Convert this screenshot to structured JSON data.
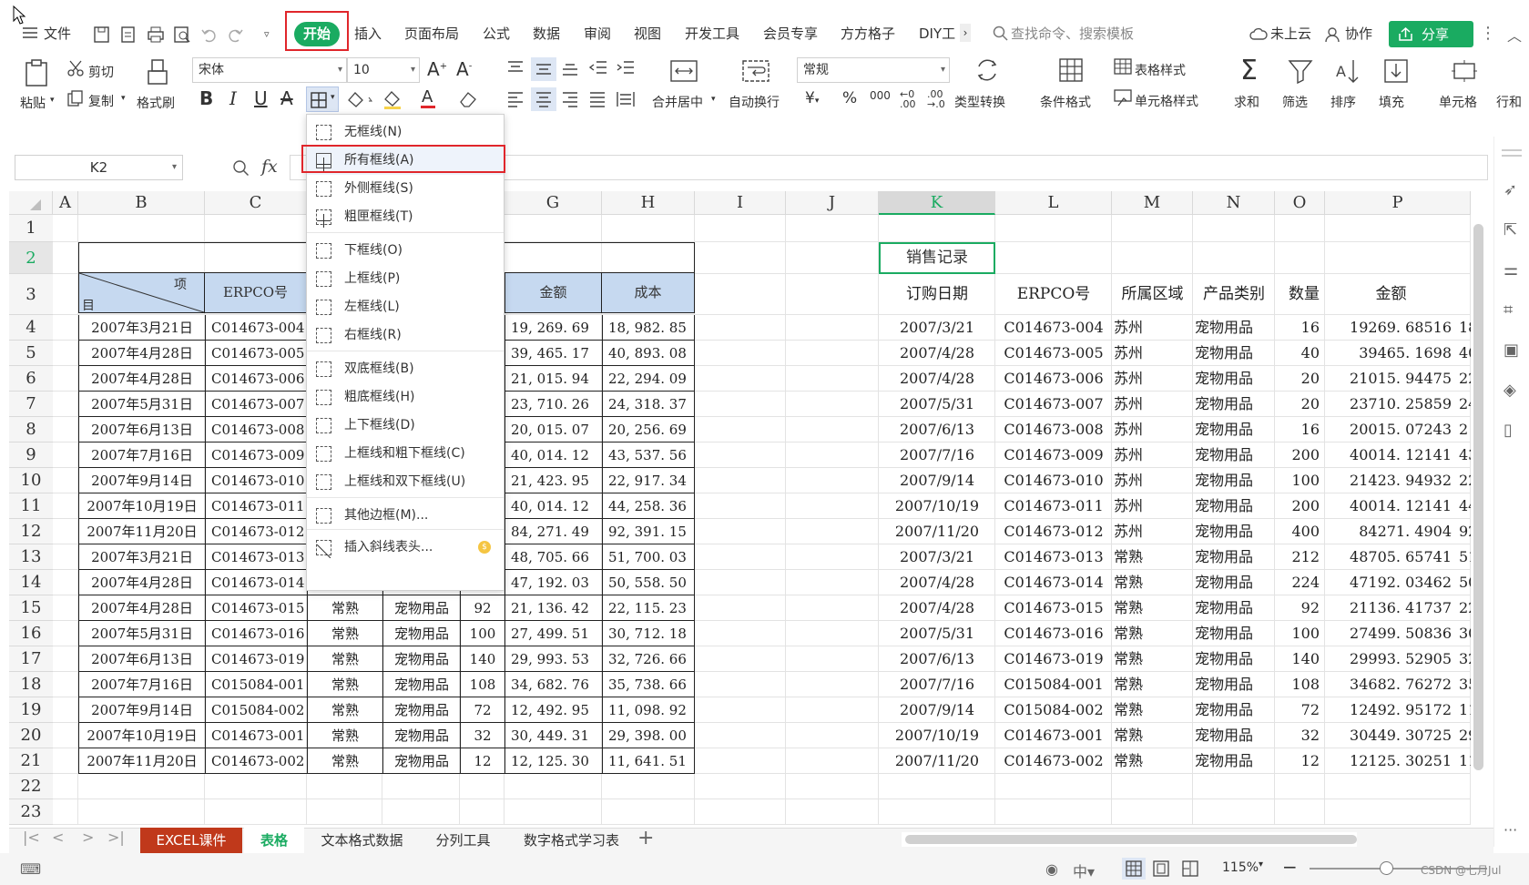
{
  "menu": {
    "file": "文件",
    "start": "开始",
    "tabs": [
      "插入",
      "页面布局",
      "公式",
      "数据",
      "审阅",
      "视图",
      "开发工具",
      "会员专享",
      "方方格子",
      "DIY工"
    ],
    "search": "查找命令、搜索模板",
    "cloud": "未上云",
    "collab": "协作",
    "share": "分享"
  },
  "ribbon": {
    "paste": "粘贴",
    "cut": "剪切",
    "copy": "复制",
    "format_painter": "格式刷",
    "font_name": "宋体",
    "font_size": "10",
    "bold": "B",
    "italic": "I",
    "underline": "U",
    "merge_center": "合并居中",
    "wrap_text": "自动换行",
    "number_format": "常规",
    "type_convert": "类型转换",
    "cond_format": "条件格式",
    "table_style": "表格样式",
    "cell_style": "单元格样式",
    "sum": "求和",
    "filter": "筛选",
    "sort": "排序",
    "fill": "填充",
    "cell": "单元格",
    "row_col": "行和"
  },
  "formula_bar": {
    "name_box": "K2",
    "fx": "fx"
  },
  "columns": [
    "A",
    "B",
    "C",
    "D",
    "E",
    "F",
    "G",
    "H",
    "I",
    "J",
    "K",
    "L",
    "M",
    "N",
    "O",
    "P"
  ],
  "rows": [
    "1",
    "2",
    "3",
    "4",
    "5",
    "6",
    "7",
    "8",
    "9",
    "10",
    "11",
    "12",
    "13",
    "14",
    "15",
    "16",
    "17",
    "18",
    "19",
    "20",
    "21",
    "22",
    "23"
  ],
  "left_table": {
    "header_diag_top": "项",
    "header_diag_bottom": "目",
    "headers": [
      "ERPCO号",
      "金额",
      "成本"
    ],
    "rows": [
      [
        "2007年3月21日",
        "C014673-004",
        "",
        "",
        "",
        "19, 269. 69",
        "18, 982. 85"
      ],
      [
        "2007年4月28日",
        "C014673-005",
        "",
        "",
        "",
        "39, 465. 17",
        "40, 893. 08"
      ],
      [
        "2007年4月28日",
        "C014673-006",
        "",
        "",
        "",
        "21, 015. 94",
        "22, 294. 09"
      ],
      [
        "2007年5月31日",
        "C014673-007",
        "",
        "",
        "",
        "23, 710. 26",
        "24, 318. 37"
      ],
      [
        "2007年6月13日",
        "C014673-008",
        "",
        "",
        "",
        "20, 015. 07",
        "20, 256. 69"
      ],
      [
        "2007年7月16日",
        "C014673-009",
        "",
        "",
        "",
        "40, 014. 12",
        "43, 537. 56"
      ],
      [
        "2007年9月14日",
        "C014673-010",
        "",
        "",
        "",
        "21, 423. 95",
        "22, 917. 34"
      ],
      [
        "2007年10月19日",
        "C014673-011",
        "",
        "",
        "",
        "40, 014. 12",
        "44, 258. 36"
      ],
      [
        "2007年11月20日",
        "C014673-012",
        "",
        "",
        "",
        "84, 271. 49",
        "92, 391. 15"
      ],
      [
        "2007年3月21日",
        "C014673-013",
        "",
        "",
        "",
        "48, 705. 66",
        "51, 700. 03"
      ],
      [
        "2007年4月28日",
        "C014673-014",
        "",
        "",
        "",
        "47, 192. 03",
        "50, 558. 50"
      ],
      [
        "2007年4月28日",
        "C014673-015",
        "常熟",
        "宠物用品",
        "92",
        "21, 136. 42",
        "22, 115. 23"
      ],
      [
        "2007年5月31日",
        "C014673-016",
        "常熟",
        "宠物用品",
        "100",
        "27, 499. 51",
        "30, 712. 18"
      ],
      [
        "2007年6月13日",
        "C014673-019",
        "常熟",
        "宠物用品",
        "140",
        "29, 993. 53",
        "32, 726. 66"
      ],
      [
        "2007年7月16日",
        "C015084-001",
        "常熟",
        "宠物用品",
        "108",
        "34, 682. 76",
        "35, 738. 66"
      ],
      [
        "2007年9月14日",
        "C015084-002",
        "常熟",
        "宠物用品",
        "72",
        "12, 492. 95",
        "11, 098. 92"
      ],
      [
        "2007年10月19日",
        "C014673-001",
        "常熟",
        "宠物用品",
        "32",
        "30, 449. 31",
        "29, 398. 00"
      ],
      [
        "2007年11月20日",
        "C014673-002",
        "常熟",
        "宠物用品",
        "12",
        "12, 125. 30",
        "11, 641. 51"
      ]
    ]
  },
  "right_table": {
    "title": "销售记录",
    "headers": [
      "订购日期",
      "ERPCO号",
      "所属区域",
      "产品类别",
      "数量",
      "金额"
    ],
    "rows": [
      [
        "2007/3/21",
        "C014673-004",
        "苏州",
        "宠物用品",
        "16",
        "19269. 68516",
        "18"
      ],
      [
        "2007/4/28",
        "C014673-005",
        "苏州",
        "宠物用品",
        "40",
        "39465. 1698",
        "40"
      ],
      [
        "2007/4/28",
        "C014673-006",
        "苏州",
        "宠物用品",
        "20",
        "21015. 94475",
        "22"
      ],
      [
        "2007/5/31",
        "C014673-007",
        "苏州",
        "宠物用品",
        "20",
        "23710. 25859",
        "24"
      ],
      [
        "2007/6/13",
        "C014673-008",
        "苏州",
        "宠物用品",
        "16",
        "20015. 07243",
        "2"
      ],
      [
        "2007/7/16",
        "C014673-009",
        "苏州",
        "宠物用品",
        "200",
        "40014. 12141",
        "43"
      ],
      [
        "2007/9/14",
        "C014673-010",
        "苏州",
        "宠物用品",
        "100",
        "21423. 94932",
        "22"
      ],
      [
        "2007/10/19",
        "C014673-011",
        "苏州",
        "宠物用品",
        "200",
        "40014. 12141",
        "44"
      ],
      [
        "2007/11/20",
        "C014673-012",
        "苏州",
        "宠物用品",
        "400",
        "84271. 4904",
        "92"
      ],
      [
        "2007/3/21",
        "C014673-013",
        "常熟",
        "宠物用品",
        "212",
        "48705. 65741",
        "51"
      ],
      [
        "2007/4/28",
        "C014673-014",
        "常熟",
        "宠物用品",
        "224",
        "47192. 03462",
        "50"
      ],
      [
        "2007/4/28",
        "C014673-015",
        "常熟",
        "宠物用品",
        "92",
        "21136. 41737",
        "22"
      ],
      [
        "2007/5/31",
        "C014673-016",
        "常熟",
        "宠物用品",
        "100",
        "27499. 50836",
        "30"
      ],
      [
        "2007/6/13",
        "C014673-019",
        "常熟",
        "宠物用品",
        "140",
        "29993. 52905",
        "32"
      ],
      [
        "2007/7/16",
        "C015084-001",
        "常熟",
        "宠物用品",
        "108",
        "34682. 76272",
        "35"
      ],
      [
        "2007/9/14",
        "C015084-002",
        "常熟",
        "宠物用品",
        "72",
        "12492. 95172",
        "11"
      ],
      [
        "2007/10/19",
        "C014673-001",
        "常熟",
        "宠物用品",
        "32",
        "30449. 30725",
        "29"
      ],
      [
        "2007/11/20",
        "C014673-002",
        "常熟",
        "宠物用品",
        "12",
        "12125. 30251",
        "11"
      ]
    ]
  },
  "border_menu": [
    {
      "label": "无框线(N)"
    },
    {
      "label": "所有框线(A)"
    },
    {
      "label": "外侧框线(S)"
    },
    {
      "label": "粗匣框线(T)"
    },
    {
      "label": "下框线(O)"
    },
    {
      "label": "上框线(P)"
    },
    {
      "label": "左框线(L)"
    },
    {
      "label": "右框线(R)"
    },
    {
      "label": "双底框线(B)"
    },
    {
      "label": "粗底框线(H)"
    },
    {
      "label": "上下框线(D)"
    },
    {
      "label": "上框线和粗下框线(C)"
    },
    {
      "label": "上框线和双下框线(U)"
    },
    {
      "label": "其他边框(M)..."
    },
    {
      "label": "插入斜线表头..."
    }
  ],
  "sheet_tabs": [
    "EXCEL课件",
    "表格",
    "文本格式数据",
    "分列工具",
    "数字格式学习表"
  ],
  "status": {
    "zoom": "115%",
    "watermark": "CSDN @七月Jul"
  }
}
